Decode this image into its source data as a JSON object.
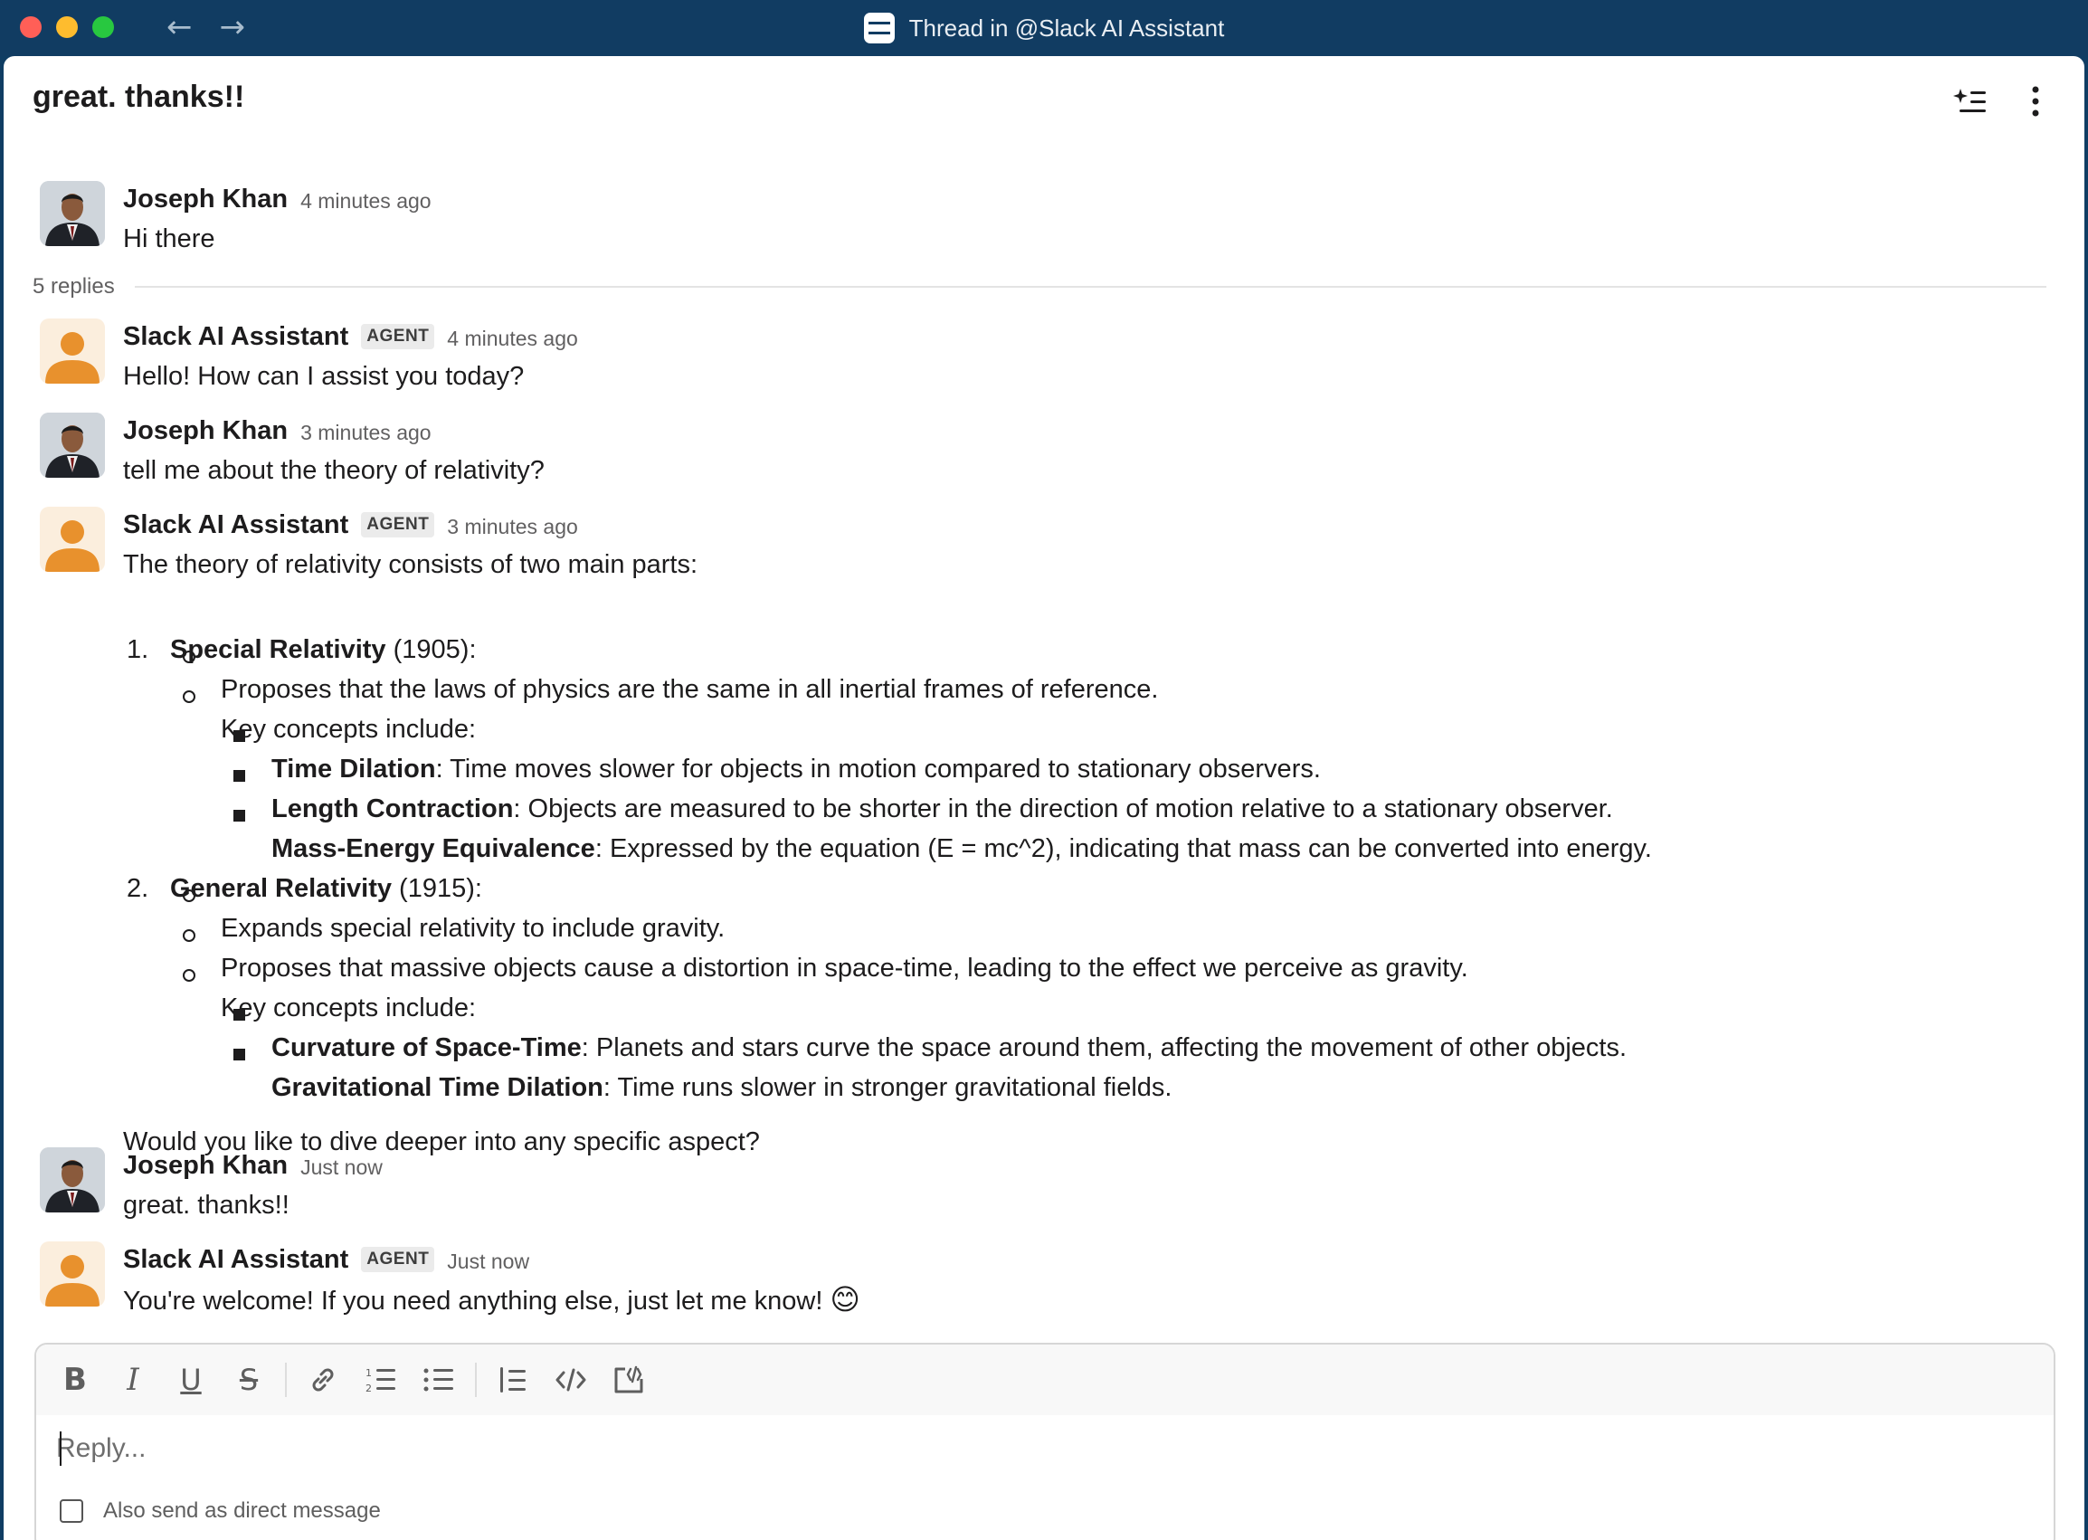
{
  "window": {
    "title": "Thread in @Slack AI Assistant",
    "app_icon": "slack-workspace-icon"
  },
  "header": {
    "title": "great. thanks!!",
    "summary_icon": "sparkle-list-icon",
    "more_icon": "vertical-ellipsis-icon"
  },
  "parent_message": {
    "author": "Joseph Khan",
    "time": "4 minutes ago",
    "text": "Hi there"
  },
  "replies_label": "5 replies",
  "messages": [
    {
      "author": "Slack AI Assistant",
      "badge": "AGENT",
      "time": "4 minutes ago",
      "text": "Hello! How can I assist you today?"
    },
    {
      "author": "Joseph Khan",
      "time": "3 minutes ago",
      "text": "tell me about the theory of relativity?"
    },
    {
      "author": "Slack AI Assistant",
      "badge": "AGENT",
      "time": "3 minutes ago",
      "intro": "The theory of relativity consists of two main parts:",
      "sections": [
        {
          "number": "1.",
          "title": "Special Relativity",
          "suffix": " (1905):",
          "bullets": [
            "Proposes that the laws of physics are the same in all inertial frames of reference.",
            "Key concepts include:"
          ],
          "concepts": [
            {
              "term": "Time Dilation",
              "desc": ": Time moves slower for objects in motion compared to stationary observers."
            },
            {
              "term": "Length Contraction",
              "desc": ": Objects are measured to be shorter in the direction of motion relative to a stationary observer."
            },
            {
              "term": "Mass-Energy Equivalence",
              "desc": ": Expressed by the equation (E = mc^2), indicating that mass can be converted into energy."
            }
          ]
        },
        {
          "number": "2.",
          "title": "General Relativity",
          "suffix": " (1915):",
          "bullets": [
            "Expands special relativity to include gravity.",
            "Proposes that massive objects cause a distortion in space-time, leading to the effect we perceive as gravity.",
            "Key concepts include:"
          ],
          "concepts": [
            {
              "term": "Curvature of Space-Time",
              "desc": ": Planets and stars curve the space around them, affecting the movement of other objects."
            },
            {
              "term": "Gravitational Time Dilation",
              "desc": ": Time runs slower in stronger gravitational fields."
            }
          ]
        }
      ],
      "outro": "Would you like to dive deeper into any specific aspect?"
    },
    {
      "author": "Joseph Khan",
      "time": "Just now",
      "text": "great. thanks!!"
    },
    {
      "author": "Slack AI Assistant",
      "badge": "AGENT",
      "time": "Just now",
      "text": "You're welcome! If you need anything else, just let me know!",
      "emoji": "😊"
    }
  ],
  "composer": {
    "placeholder": "Reply...",
    "toolbar": [
      "bold-icon",
      "italic-icon",
      "underline-icon",
      "strikethrough-icon",
      "link-icon",
      "numbered-list-icon",
      "bulleted-list-icon",
      "blockquote-icon",
      "code-icon",
      "code-block-icon"
    ],
    "dm_label": "Also send as direct message"
  },
  "colors": {
    "titlebar": "#113c62",
    "ai_avatar": "#e8912d",
    "text": "#1d1c1d"
  }
}
